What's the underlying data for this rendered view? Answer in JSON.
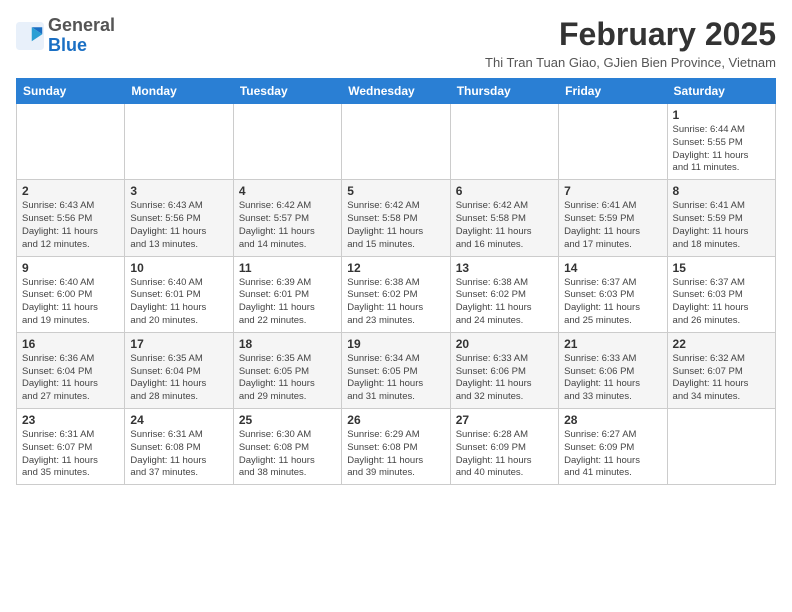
{
  "logo": {
    "general": "General",
    "blue": "Blue"
  },
  "header": {
    "month_year": "February 2025",
    "subtitle": "Thi Tran Tuan Giao, GJien Bien Province, Vietnam"
  },
  "weekdays": [
    "Sunday",
    "Monday",
    "Tuesday",
    "Wednesday",
    "Thursday",
    "Friday",
    "Saturday"
  ],
  "weeks": [
    [
      {
        "day": "",
        "info": ""
      },
      {
        "day": "",
        "info": ""
      },
      {
        "day": "",
        "info": ""
      },
      {
        "day": "",
        "info": ""
      },
      {
        "day": "",
        "info": ""
      },
      {
        "day": "",
        "info": ""
      },
      {
        "day": "1",
        "info": "Sunrise: 6:44 AM\nSunset: 5:55 PM\nDaylight: 11 hours\nand 11 minutes."
      }
    ],
    [
      {
        "day": "2",
        "info": "Sunrise: 6:43 AM\nSunset: 5:56 PM\nDaylight: 11 hours\nand 12 minutes."
      },
      {
        "day": "3",
        "info": "Sunrise: 6:43 AM\nSunset: 5:56 PM\nDaylight: 11 hours\nand 13 minutes."
      },
      {
        "day": "4",
        "info": "Sunrise: 6:42 AM\nSunset: 5:57 PM\nDaylight: 11 hours\nand 14 minutes."
      },
      {
        "day": "5",
        "info": "Sunrise: 6:42 AM\nSunset: 5:58 PM\nDaylight: 11 hours\nand 15 minutes."
      },
      {
        "day": "6",
        "info": "Sunrise: 6:42 AM\nSunset: 5:58 PM\nDaylight: 11 hours\nand 16 minutes."
      },
      {
        "day": "7",
        "info": "Sunrise: 6:41 AM\nSunset: 5:59 PM\nDaylight: 11 hours\nand 17 minutes."
      },
      {
        "day": "8",
        "info": "Sunrise: 6:41 AM\nSunset: 5:59 PM\nDaylight: 11 hours\nand 18 minutes."
      }
    ],
    [
      {
        "day": "9",
        "info": "Sunrise: 6:40 AM\nSunset: 6:00 PM\nDaylight: 11 hours\nand 19 minutes."
      },
      {
        "day": "10",
        "info": "Sunrise: 6:40 AM\nSunset: 6:01 PM\nDaylight: 11 hours\nand 20 minutes."
      },
      {
        "day": "11",
        "info": "Sunrise: 6:39 AM\nSunset: 6:01 PM\nDaylight: 11 hours\nand 22 minutes."
      },
      {
        "day": "12",
        "info": "Sunrise: 6:38 AM\nSunset: 6:02 PM\nDaylight: 11 hours\nand 23 minutes."
      },
      {
        "day": "13",
        "info": "Sunrise: 6:38 AM\nSunset: 6:02 PM\nDaylight: 11 hours\nand 24 minutes."
      },
      {
        "day": "14",
        "info": "Sunrise: 6:37 AM\nSunset: 6:03 PM\nDaylight: 11 hours\nand 25 minutes."
      },
      {
        "day": "15",
        "info": "Sunrise: 6:37 AM\nSunset: 6:03 PM\nDaylight: 11 hours\nand 26 minutes."
      }
    ],
    [
      {
        "day": "16",
        "info": "Sunrise: 6:36 AM\nSunset: 6:04 PM\nDaylight: 11 hours\nand 27 minutes."
      },
      {
        "day": "17",
        "info": "Sunrise: 6:35 AM\nSunset: 6:04 PM\nDaylight: 11 hours\nand 28 minutes."
      },
      {
        "day": "18",
        "info": "Sunrise: 6:35 AM\nSunset: 6:05 PM\nDaylight: 11 hours\nand 29 minutes."
      },
      {
        "day": "19",
        "info": "Sunrise: 6:34 AM\nSunset: 6:05 PM\nDaylight: 11 hours\nand 31 minutes."
      },
      {
        "day": "20",
        "info": "Sunrise: 6:33 AM\nSunset: 6:06 PM\nDaylight: 11 hours\nand 32 minutes."
      },
      {
        "day": "21",
        "info": "Sunrise: 6:33 AM\nSunset: 6:06 PM\nDaylight: 11 hours\nand 33 minutes."
      },
      {
        "day": "22",
        "info": "Sunrise: 6:32 AM\nSunset: 6:07 PM\nDaylight: 11 hours\nand 34 minutes."
      }
    ],
    [
      {
        "day": "23",
        "info": "Sunrise: 6:31 AM\nSunset: 6:07 PM\nDaylight: 11 hours\nand 35 minutes."
      },
      {
        "day": "24",
        "info": "Sunrise: 6:31 AM\nSunset: 6:08 PM\nDaylight: 11 hours\nand 37 minutes."
      },
      {
        "day": "25",
        "info": "Sunrise: 6:30 AM\nSunset: 6:08 PM\nDaylight: 11 hours\nand 38 minutes."
      },
      {
        "day": "26",
        "info": "Sunrise: 6:29 AM\nSunset: 6:08 PM\nDaylight: 11 hours\nand 39 minutes."
      },
      {
        "day": "27",
        "info": "Sunrise: 6:28 AM\nSunset: 6:09 PM\nDaylight: 11 hours\nand 40 minutes."
      },
      {
        "day": "28",
        "info": "Sunrise: 6:27 AM\nSunset: 6:09 PM\nDaylight: 11 hours\nand 41 minutes."
      },
      {
        "day": "",
        "info": ""
      }
    ]
  ]
}
